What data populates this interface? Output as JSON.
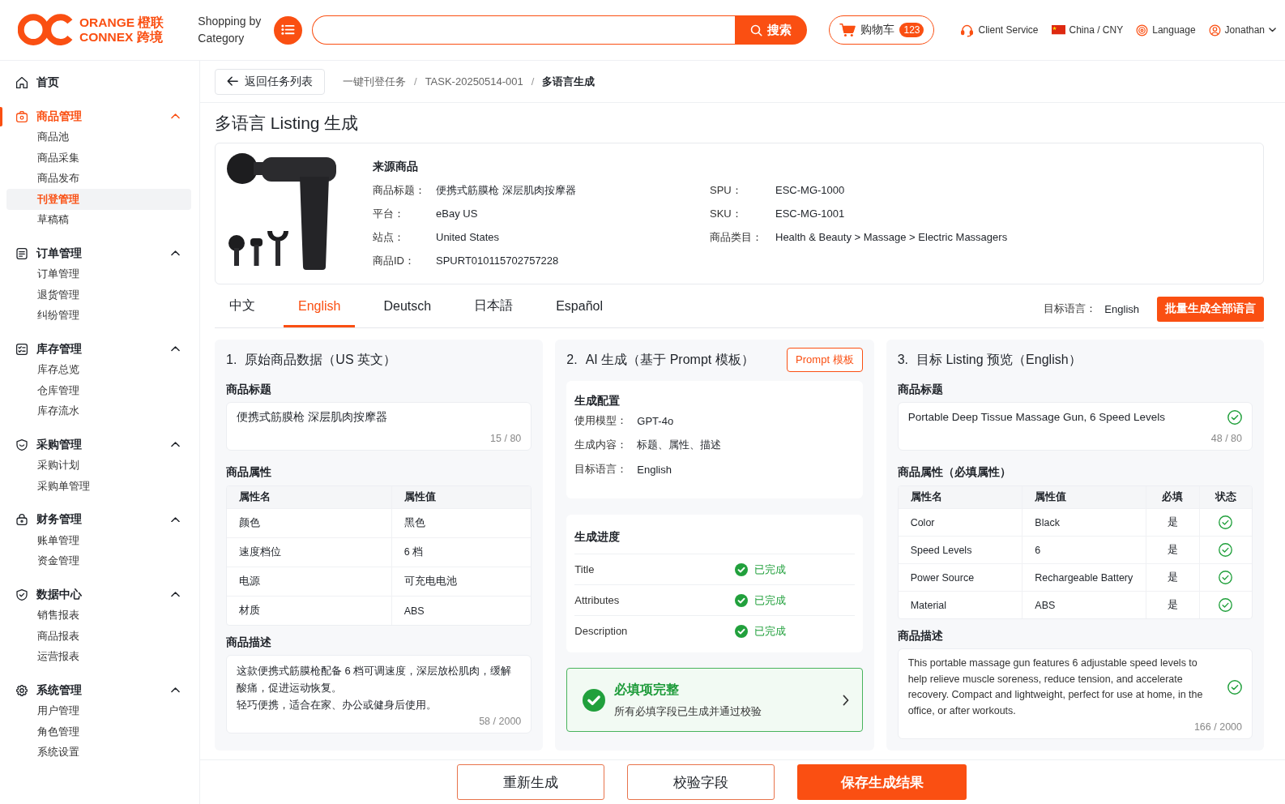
{
  "header": {
    "logo": {
      "lines": [
        "ORANGE 橙联",
        "CONNEX 跨境"
      ]
    },
    "category_label": "Shopping by Category",
    "search": {
      "button": "搜索"
    },
    "cart": {
      "label": "购物车",
      "badge": "123"
    },
    "links": [
      "Client Service",
      "China / CNY",
      "Language"
    ],
    "user": "Jonathan"
  },
  "sidebar": {
    "items": [
      {
        "kind": "link",
        "label": "首页",
        "selected": false
      },
      {
        "kind": "group",
        "label": "商品管理",
        "selected": true,
        "expanded": true,
        "children": [
          {
            "label": "商品池",
            "selected": false
          },
          {
            "label": "商品采集",
            "selected": false
          },
          {
            "label": "商品发布",
            "selected": false
          },
          {
            "label": "刊登管理",
            "selected": true
          },
          {
            "label": "草稿稿",
            "selected": false
          }
        ]
      },
      {
        "kind": "group",
        "label": "订单管理",
        "selected": false,
        "expanded": true,
        "children": [
          {
            "label": "订单管理",
            "selected": false
          },
          {
            "label": "退货管理",
            "selected": false
          },
          {
            "label": "纠纷管理",
            "selected": false
          }
        ]
      },
      {
        "kind": "group",
        "label": "库存管理",
        "selected": false,
        "expanded": true,
        "children": [
          {
            "label": "库存总览",
            "selected": false
          },
          {
            "label": "仓库管理",
            "selected": false
          },
          {
            "label": "库存流水",
            "selected": false
          }
        ]
      },
      {
        "kind": "group",
        "label": "采购管理",
        "selected": false,
        "expanded": true,
        "children": [
          {
            "label": "采购计划",
            "selected": false
          },
          {
            "label": "采购单管理",
            "selected": false
          }
        ]
      },
      {
        "kind": "group",
        "label": "财务管理",
        "selected": false,
        "expanded": true,
        "children": [
          {
            "label": "账单管理",
            "selected": false
          },
          {
            "label": "资金管理",
            "selected": false
          }
        ]
      },
      {
        "kind": "group",
        "label": "数据中心",
        "selected": false,
        "expanded": true,
        "children": [
          {
            "label": "销售报表",
            "selected": false
          },
          {
            "label": "商品报表",
            "selected": false
          },
          {
            "label": "运营报表",
            "selected": false
          }
        ]
      },
      {
        "kind": "group",
        "label": "系统管理",
        "selected": false,
        "expanded": true,
        "children": [
          {
            "label": "用户管理",
            "selected": false
          },
          {
            "label": "角色管理",
            "selected": false
          },
          {
            "label": "系统设置",
            "selected": false
          }
        ]
      }
    ]
  },
  "breadcrumb": {
    "back": "返回任务列表",
    "separator": "/",
    "items": [
      {
        "label": "一键刊登任务",
        "current": false
      },
      {
        "label": "TASK-20250514-001",
        "current": false
      },
      {
        "label": "多语言生成",
        "current": true
      }
    ]
  },
  "page_title": "多语言 Listing 生成",
  "source_product": {
    "heading": "来源商品",
    "fields_left": [
      {
        "label": "商品标题：",
        "value": "便携式筋膜枪 深层肌肉按摩器"
      },
      {
        "label": "平台：",
        "value": "eBay US"
      },
      {
        "label": "站点：",
        "value": "United States"
      },
      {
        "label": "商品ID：",
        "value": "SPURT010115702757228"
      }
    ],
    "fields_right": [
      {
        "label": "SPU：",
        "value": "ESC-MG-1000"
      },
      {
        "label": "SKU：",
        "value": "ESC-MG-1001"
      },
      {
        "label": "商品类目：",
        "value": "Health & Beauty > Massage > Electric Massagers"
      }
    ]
  },
  "tabs": [
    {
      "label": "中文",
      "selected": false
    },
    {
      "label": "English",
      "selected": true
    },
    {
      "label": "Deutsch",
      "selected": false
    },
    {
      "label": "日本語",
      "selected": false
    },
    {
      "label": "Español",
      "selected": false
    }
  ],
  "target_language": {
    "label": "目标语言：",
    "value": "English"
  },
  "batch_button": "批量生成全部语言",
  "original_panel": {
    "number": "1.",
    "title": "原始商品数据（US 英文）",
    "title_section": {
      "heading": "商品标题",
      "value": "便携式筋膜枪 深层肌肉按摩器",
      "count": "15 / 80"
    },
    "attributes": {
      "heading": "商品属性",
      "columns": [
        "属性名",
        "属性值"
      ],
      "rows": [
        {
          "name": "颜色",
          "value": "黑色"
        },
        {
          "name": "速度档位",
          "value": "6 档"
        },
        {
          "name": "电源",
          "value": "可充电电池"
        },
        {
          "name": "材质",
          "value": "ABS"
        }
      ]
    },
    "description": {
      "heading": "商品描述",
      "paragraphs": [
        "这款便携式筋膜枪配备 6 档可调速度，深层放松肌肉，缓解酸痛，促进运动恢复。",
        "轻巧便携，适合在家、办公或健身后使用。"
      ],
      "count": "58 / 2000"
    }
  },
  "ai_panel": {
    "number": "2.",
    "title": "AI 生成（基于 Prompt 模板）",
    "template_button": "Prompt 模板",
    "config": {
      "heading": "生成配置",
      "rows": [
        {
          "label": "使用模型：",
          "value": "GPT-4o"
        },
        {
          "label": "生成内容：",
          "value": "标题、属性、描述"
        },
        {
          "label": "目标语言：",
          "value": "English"
        }
      ]
    },
    "progress": {
      "heading": "生成进度",
      "items": [
        {
          "label": "Title",
          "status": "已完成",
          "done": true
        },
        {
          "label": "Attributes",
          "status": "已完成",
          "done": true
        },
        {
          "label": "Description",
          "status": "已完成",
          "done": true
        }
      ]
    },
    "validation": {
      "title": "必填项完整",
      "message": "所有必填字段已生成并通过校验",
      "passed": true
    }
  },
  "preview_panel": {
    "number": "3.",
    "title": "目标 Listing 预览（English）",
    "title_section": {
      "heading": "商品标题",
      "value": "Portable Deep Tissue Massage Gun, 6 Speed Levels",
      "count": "48 / 80",
      "valid": true
    },
    "attributes": {
      "heading": "商品属性（必填属性）",
      "columns": [
        "属性名",
        "属性值",
        "必填",
        "状态"
      ],
      "rows": [
        {
          "name": "Color",
          "value": "Black",
          "required": "是",
          "valid": true
        },
        {
          "name": "Speed Levels",
          "value": "6",
          "required": "是",
          "valid": true
        },
        {
          "name": "Power Source",
          "value": "Rechargeable Battery",
          "required": "是",
          "valid": true
        },
        {
          "name": "Material",
          "value": "ABS",
          "required": "是",
          "valid": true
        }
      ]
    },
    "description": {
      "heading": "商品描述",
      "paragraphs": [
        "This portable massage gun features 6 adjustable speed levels to help relieve muscle soreness, reduce tension, and accelerate recovery. Compact and lightweight, perfect for use at home, in the office, or after workouts."
      ],
      "count": "166 / 2000",
      "valid": true
    }
  },
  "footer_buttons": [
    {
      "label": "重新生成",
      "kind": "secondary"
    },
    {
      "label": "校验字段",
      "kind": "secondary"
    },
    {
      "label": "保存生成结果",
      "kind": "primary"
    }
  ]
}
